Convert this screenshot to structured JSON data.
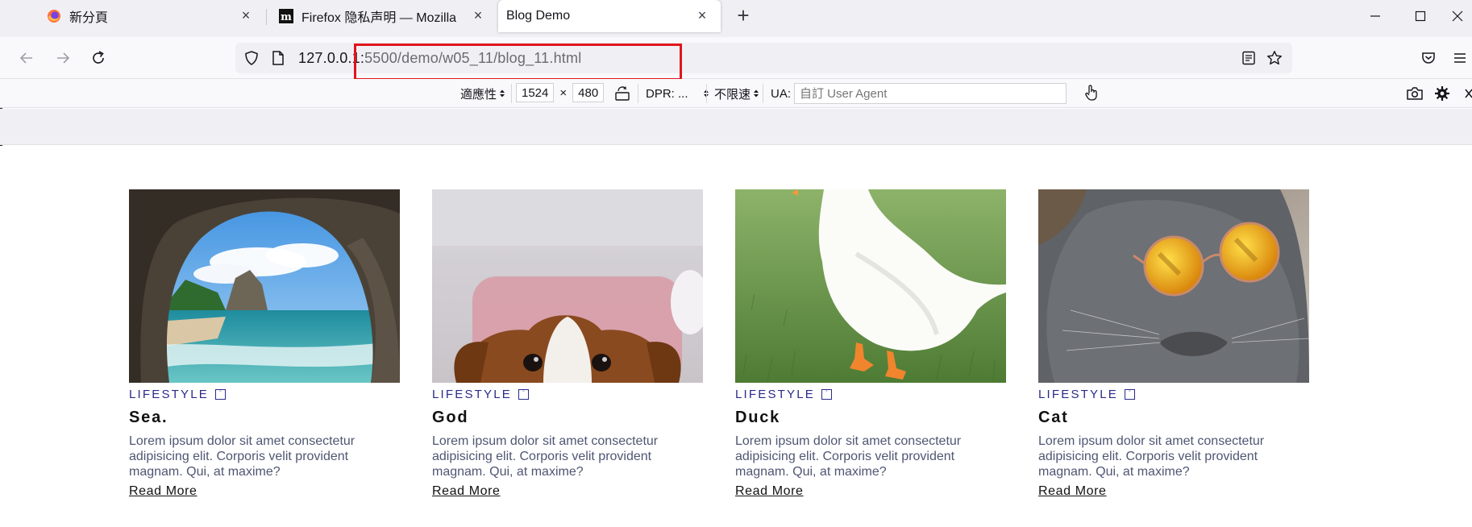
{
  "browser": {
    "tabs": [
      {
        "label": "新分頁",
        "active": false
      },
      {
        "label": "Firefox 隐私声明 — Mozilla",
        "active": false
      },
      {
        "label": "Blog Demo",
        "active": true
      }
    ],
    "url_host": "127.0.0.1:",
    "url_path": "5500/demo/w05_11/blog_11.html"
  },
  "rdm": {
    "device_label": "適應性",
    "width": "1524",
    "times": "×",
    "height": "480",
    "dpr_label": "DPR: ...",
    "throttle_label": "不限速",
    "ua_label": "UA:",
    "ua_placeholder": "自訂 User Agent"
  },
  "cards": [
    {
      "category": "LIFESTYLE",
      "title": "Sea.",
      "description": "Lorem ipsum dolor sit amet consectetur adipisicing elit. Corporis velit provident magnam. Qui, at maxime?",
      "link": "Read More"
    },
    {
      "category": "LIFESTYLE",
      "title": "God",
      "description": "Lorem ipsum dolor sit amet consectetur adipisicing elit. Corporis velit provident magnam. Qui, at maxime?",
      "link": "Read More"
    },
    {
      "category": "LIFESTYLE",
      "title": "Duck",
      "description": "Lorem ipsum dolor sit amet consectetur adipisicing elit. Corporis velit provident magnam. Qui, at maxime?",
      "link": "Read More"
    },
    {
      "category": "LIFESTYLE",
      "title": "Cat",
      "description": "Lorem ipsum dolor sit amet consectetur adipisicing elit. Corporis velit provident magnam. Qui, at maxime?",
      "link": "Read More"
    }
  ],
  "icons": {
    "tab1": "firefox-logo-icon",
    "tab2": "mozilla-m-icon",
    "back": "back-arrow-icon",
    "forward": "forward-arrow-icon",
    "reload": "reload-icon",
    "shield": "tracking-shield-icon",
    "page": "page-info-icon",
    "reader": "reader-view-icon",
    "bookmark": "bookmark-star-icon",
    "pocket": "pocket-icon",
    "menu": "hamburger-menu-icon"
  },
  "colors": {
    "highlight": "#e0151c",
    "category": "#2a2a8a",
    "description": "#4f5672"
  }
}
